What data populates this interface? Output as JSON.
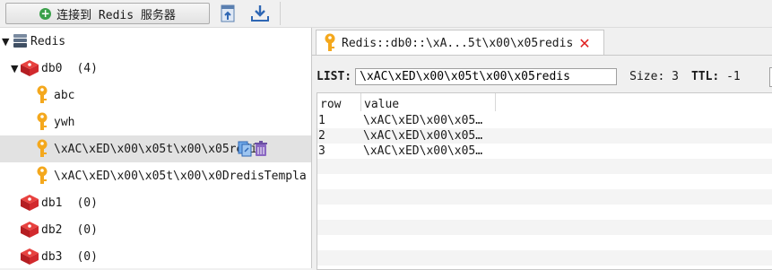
{
  "toolbar": {
    "connect_label": "连接到 Redis 服务器",
    "import_icon": "import-icon",
    "export_icon": "download-icon"
  },
  "tree": {
    "root": {
      "label": "Redis",
      "icon": "redis-server-icon"
    },
    "databases": [
      {
        "name": "db0",
        "count": "(4)",
        "expanded": true
      },
      {
        "name": "db1",
        "count": "(0)"
      },
      {
        "name": "db2",
        "count": "(0)"
      },
      {
        "name": "db3",
        "count": "(0)"
      }
    ],
    "keys": [
      {
        "label": "abc"
      },
      {
        "label": "ywh"
      },
      {
        "label": "\\xAC\\xED\\x00\\x05t\\x00\\x05redis",
        "selected": true
      },
      {
        "label": "\\xAC\\xED\\x00\\x05t\\x00\\x0DredisTempla"
      }
    ]
  },
  "tab": {
    "title": "Redis::db0::\\xA...5t\\x00\\x05redis",
    "close_icon": "close-icon"
  },
  "key_info": {
    "type_label": "LIST:",
    "key_name": "\\xAC\\xED\\x00\\x05t\\x00\\x05redis",
    "size_text": "Size: 3",
    "ttl_label": "TTL:",
    "ttl_value": "-1"
  },
  "table": {
    "columns": [
      "row",
      "value"
    ],
    "rows": [
      {
        "row": "1",
        "value": "\\xAC\\xED\\x00\\x05…"
      },
      {
        "row": "2",
        "value": "\\xAC\\xED\\x00\\x05…"
      },
      {
        "row": "3",
        "value": "\\xAC\\xED\\x00\\x05…"
      }
    ]
  },
  "colors": {
    "key_gold": "#f4a81d",
    "db_red": "#d9262b",
    "close_red": "#e02020",
    "selection": "#e2e2e2"
  }
}
